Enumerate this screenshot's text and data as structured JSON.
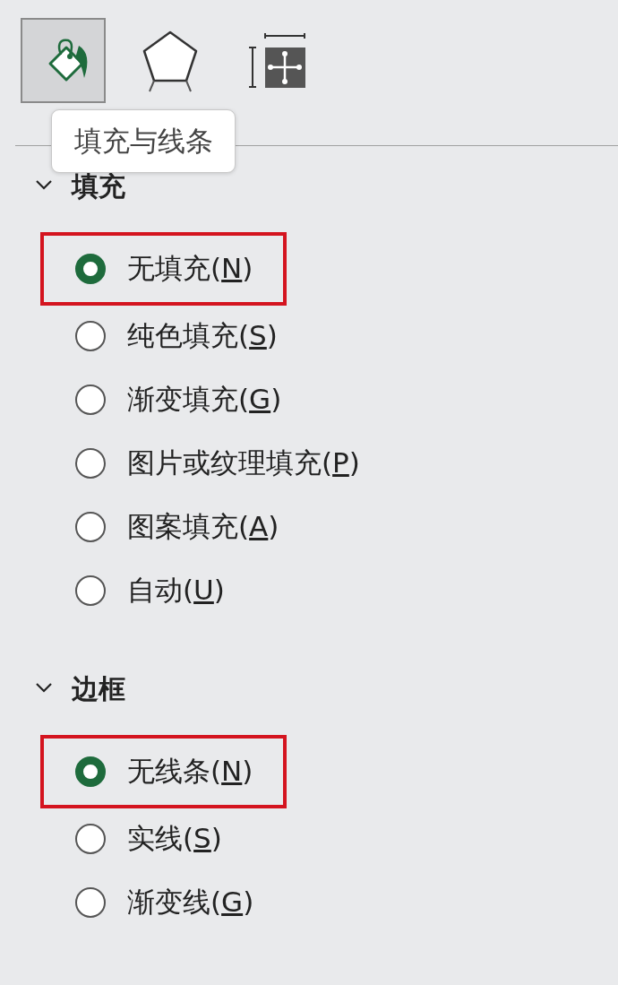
{
  "toolbar": [
    {
      "kind": "fill-line",
      "selected": true
    },
    {
      "kind": "effects",
      "selected": false
    },
    {
      "kind": "size",
      "selected": false
    }
  ],
  "tooltip": "填充与线条",
  "sections": [
    {
      "title": "填充",
      "expanded": true,
      "options": [
        {
          "label": "无填充(",
          "key": "N",
          "tail": ")",
          "selected": true,
          "highlighted": true
        },
        {
          "label": "纯色填充(",
          "key": "S",
          "tail": ")",
          "selected": false,
          "highlighted": false
        },
        {
          "label": "渐变填充(",
          "key": "G",
          "tail": ")",
          "selected": false,
          "highlighted": false
        },
        {
          "label": "图片或纹理填充(",
          "key": "P",
          "tail": ")",
          "selected": false,
          "highlighted": false
        },
        {
          "label": "图案填充(",
          "key": "A",
          "tail": ")",
          "selected": false,
          "highlighted": false
        },
        {
          "label": "自动(",
          "key": "U",
          "tail": ")",
          "selected": false,
          "highlighted": false
        }
      ]
    },
    {
      "title": "边框",
      "expanded": true,
      "options": [
        {
          "label": "无线条(",
          "key": "N",
          "tail": ")",
          "selected": true,
          "highlighted": true
        },
        {
          "label": "实线(",
          "key": "S",
          "tail": ")",
          "selected": false,
          "highlighted": false
        },
        {
          "label": "渐变线(",
          "key": "G",
          "tail": ")",
          "selected": false,
          "highlighted": false
        }
      ]
    }
  ]
}
